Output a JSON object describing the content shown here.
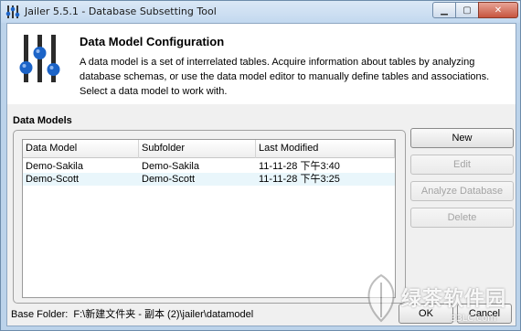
{
  "window": {
    "title": "Jailer 5.5.1 - Database Subsetting Tool",
    "minimize_glyph": "▁",
    "maximize_glyph": "▢",
    "close_glyph": "✕",
    "icon": "jailer-sliders-icon"
  },
  "header": {
    "title": "Data Model Configuration",
    "description": "A data model is a set of interrelated tables. Acquire information about tables by analyzing database schemas, or use the data model editor to manually define tables and associations. Select a data model to work with."
  },
  "data_models": {
    "section_label": "Data Models",
    "columns": [
      "Data Model",
      "Subfolder",
      "Last Modified"
    ],
    "rows": [
      [
        "Demo-Sakila",
        "Demo-Sakila",
        "11-11-28 下午3:40"
      ],
      [
        "Demo-Scott",
        "Demo-Scott",
        "11-11-28 下午3:25"
      ]
    ]
  },
  "buttons": {
    "new": "New",
    "edit": "Edit",
    "analyze": "Analyze Database",
    "delete": "Delete",
    "ok": "OK",
    "cancel": "Cancel"
  },
  "footer": {
    "base_folder_label": "Base Folder:",
    "base_folder_value": "F:\\新建文件夹 - 副本 (2)\\jailer\\datamodel"
  },
  "watermark": {
    "name": "绿茶软件园",
    "url": "33LC.com"
  },
  "colors": {
    "accent_blue": "#1c64c8",
    "slider_dark": "#2b2b2b",
    "title_bar": "#c2d8ef",
    "close_button": "#c7553f",
    "row_alt": "#e9f6fb"
  }
}
